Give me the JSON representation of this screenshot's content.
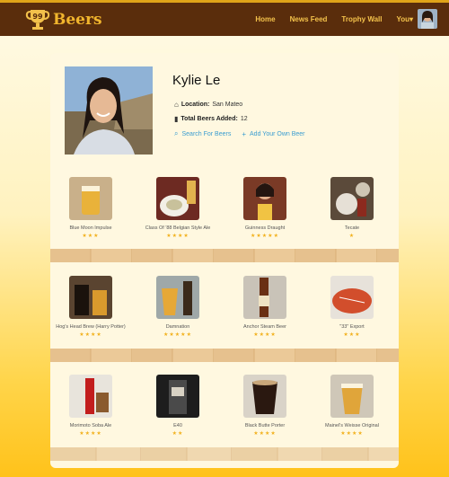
{
  "brand": {
    "name": "Beers",
    "badge": "99"
  },
  "nav": {
    "links": [
      "Home",
      "News Feed",
      "Trophy Wall",
      "You▾"
    ]
  },
  "profile": {
    "name": "Kylie Le",
    "location_label": "Location:",
    "location_value": "San Mateo",
    "total_label": "Total Beers Added:",
    "total_value": "12",
    "search_link": "Search For Beers",
    "add_link": "Add Your Own Beer"
  },
  "beers": [
    {
      "name": "Blue Moon Impulse",
      "stars": "★★★"
    },
    {
      "name": "Class Of '88 Belgian Style Ale",
      "stars": "★★★★"
    },
    {
      "name": "Guinness Draught",
      "stars": "★★★★★"
    },
    {
      "name": "Tecate",
      "stars": "★"
    },
    {
      "name": "Hog's Head Brew (Harry Potter)",
      "stars": "★★★★"
    },
    {
      "name": "Damnation",
      "stars": "★★★★★"
    },
    {
      "name": "Anchor Steam Beer",
      "stars": "★★★★"
    },
    {
      "name": "\"33\" Export",
      "stars": "★★★"
    },
    {
      "name": "Morimoto Soba Ale",
      "stars": "★★★★"
    },
    {
      "name": "E40",
      "stars": "★★"
    },
    {
      "name": "Black Butte Porter",
      "stars": "★★★★"
    },
    {
      "name": "Mainel's Weisse Original",
      "stars": "★★★★"
    }
  ],
  "colors": {
    "nav_bg": "#5a2d0c",
    "accent": "#f1b52d",
    "link": "#3a9dd0",
    "star": "#f2b11d"
  }
}
